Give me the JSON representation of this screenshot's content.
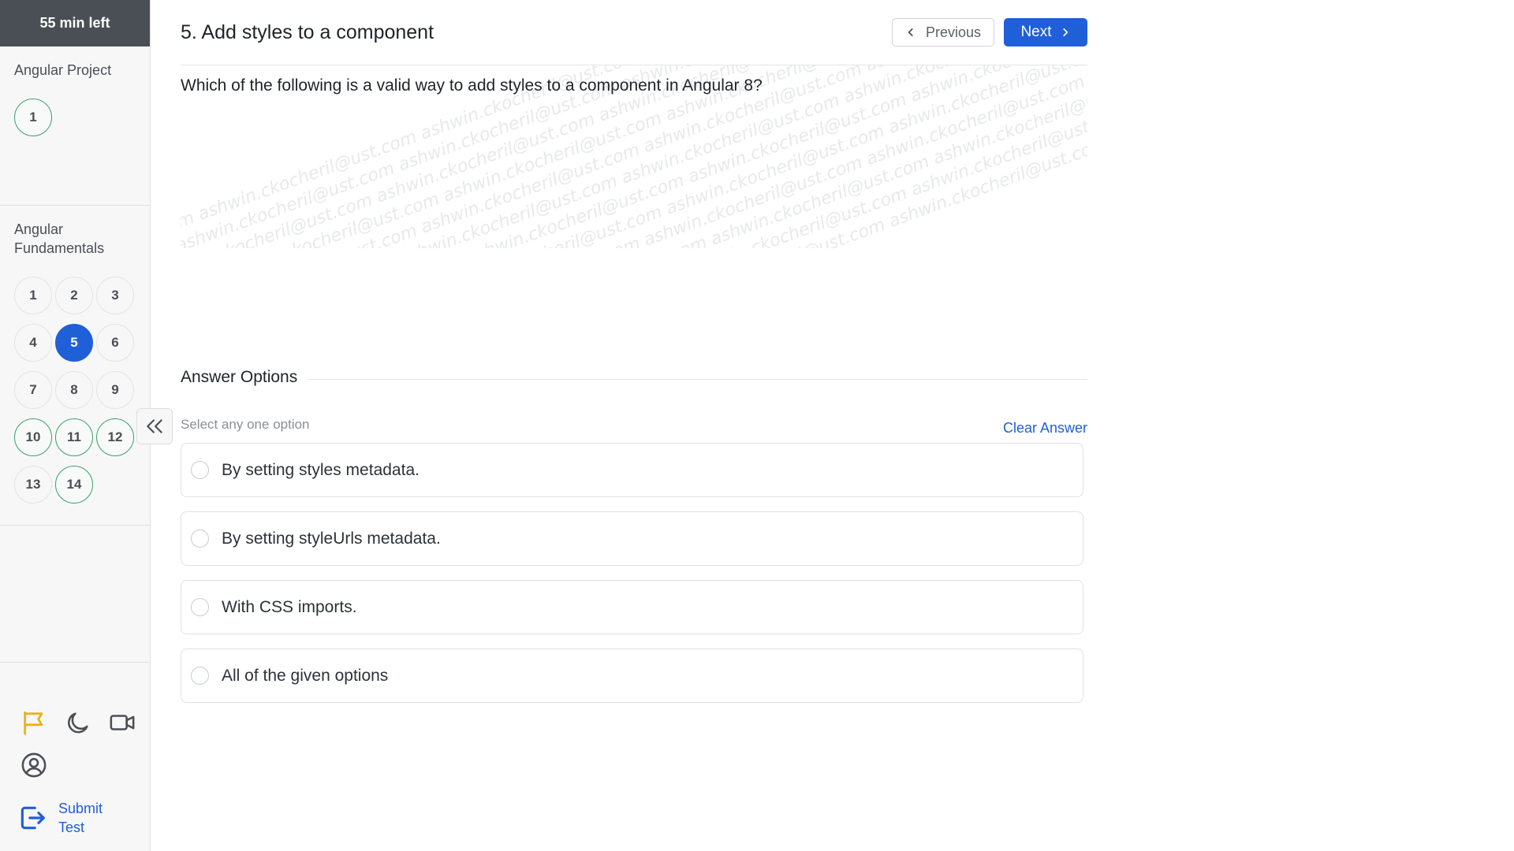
{
  "timer": {
    "label": "55 min left"
  },
  "sidebar": {
    "sections": [
      {
        "title": "Angular Project",
        "questions": [
          {
            "num": "1",
            "state": "answered"
          }
        ]
      },
      {
        "title": "Angular Fundamentals",
        "questions": [
          {
            "num": "1",
            "state": "unanswered"
          },
          {
            "num": "2",
            "state": "unanswered"
          },
          {
            "num": "3",
            "state": "unanswered"
          },
          {
            "num": "4",
            "state": "unanswered"
          },
          {
            "num": "5",
            "state": "current"
          },
          {
            "num": "6",
            "state": "unanswered"
          },
          {
            "num": "7",
            "state": "unanswered"
          },
          {
            "num": "8",
            "state": "unanswered"
          },
          {
            "num": "9",
            "state": "unanswered"
          },
          {
            "num": "10",
            "state": "answered"
          },
          {
            "num": "11",
            "state": "answered"
          },
          {
            "num": "12",
            "state": "answered"
          },
          {
            "num": "13",
            "state": "unanswered"
          },
          {
            "num": "14",
            "state": "answered"
          }
        ]
      }
    ],
    "tools": [
      "flag-icon",
      "moon-icon",
      "video-camera-icon",
      "user-circle-icon"
    ],
    "submit_label": "Submit Test"
  },
  "header": {
    "title": "5. Add styles to a component",
    "prev_label": "Previous",
    "next_label": "Next"
  },
  "question": {
    "text": "Which of the following is a valid way to add styles to a component in Angular 8?",
    "watermark": "ashwin.ckocheril@ust.com"
  },
  "answers": {
    "heading": "Answer Options",
    "hint": "Select any one option",
    "clear_label": "Clear Answer",
    "options": [
      "By setting styles metadata.",
      "By setting styleUrls metadata.",
      "With CSS imports.",
      "All of the given options"
    ]
  },
  "colors": {
    "accent": "#1f5fd8",
    "answered": "#38a169",
    "flag": "#e8b21c",
    "timer_bg": "#4a4f55"
  }
}
